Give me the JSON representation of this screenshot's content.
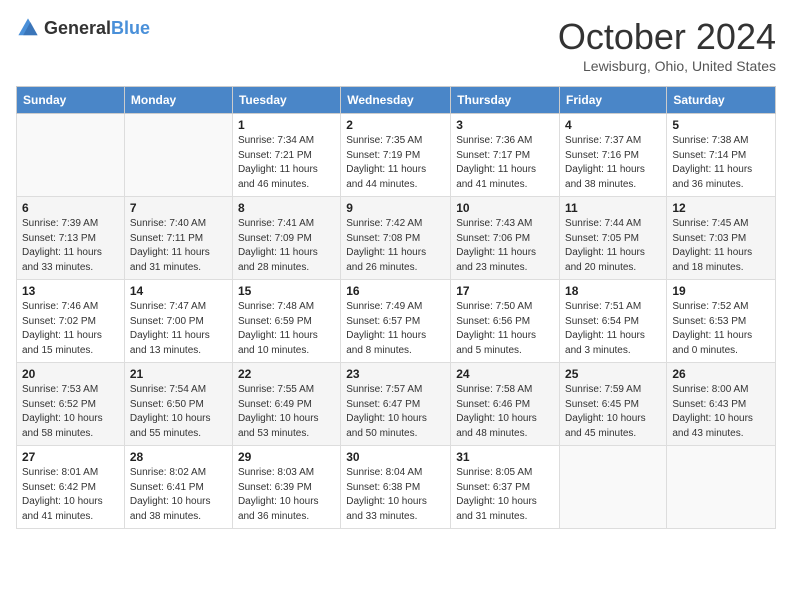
{
  "header": {
    "logo_general": "General",
    "logo_blue": "Blue",
    "month_title": "October 2024",
    "location": "Lewisburg, Ohio, United States"
  },
  "days_of_week": [
    "Sunday",
    "Monday",
    "Tuesday",
    "Wednesday",
    "Thursday",
    "Friday",
    "Saturday"
  ],
  "weeks": [
    [
      {
        "day": "",
        "info": ""
      },
      {
        "day": "",
        "info": ""
      },
      {
        "day": "1",
        "sunrise": "Sunrise: 7:34 AM",
        "sunset": "Sunset: 7:21 PM",
        "daylight": "Daylight: 11 hours and 46 minutes."
      },
      {
        "day": "2",
        "sunrise": "Sunrise: 7:35 AM",
        "sunset": "Sunset: 7:19 PM",
        "daylight": "Daylight: 11 hours and 44 minutes."
      },
      {
        "day": "3",
        "sunrise": "Sunrise: 7:36 AM",
        "sunset": "Sunset: 7:17 PM",
        "daylight": "Daylight: 11 hours and 41 minutes."
      },
      {
        "day": "4",
        "sunrise": "Sunrise: 7:37 AM",
        "sunset": "Sunset: 7:16 PM",
        "daylight": "Daylight: 11 hours and 38 minutes."
      },
      {
        "day": "5",
        "sunrise": "Sunrise: 7:38 AM",
        "sunset": "Sunset: 7:14 PM",
        "daylight": "Daylight: 11 hours and 36 minutes."
      }
    ],
    [
      {
        "day": "6",
        "sunrise": "Sunrise: 7:39 AM",
        "sunset": "Sunset: 7:13 PM",
        "daylight": "Daylight: 11 hours and 33 minutes."
      },
      {
        "day": "7",
        "sunrise": "Sunrise: 7:40 AM",
        "sunset": "Sunset: 7:11 PM",
        "daylight": "Daylight: 11 hours and 31 minutes."
      },
      {
        "day": "8",
        "sunrise": "Sunrise: 7:41 AM",
        "sunset": "Sunset: 7:09 PM",
        "daylight": "Daylight: 11 hours and 28 minutes."
      },
      {
        "day": "9",
        "sunrise": "Sunrise: 7:42 AM",
        "sunset": "Sunset: 7:08 PM",
        "daylight": "Daylight: 11 hours and 26 minutes."
      },
      {
        "day": "10",
        "sunrise": "Sunrise: 7:43 AM",
        "sunset": "Sunset: 7:06 PM",
        "daylight": "Daylight: 11 hours and 23 minutes."
      },
      {
        "day": "11",
        "sunrise": "Sunrise: 7:44 AM",
        "sunset": "Sunset: 7:05 PM",
        "daylight": "Daylight: 11 hours and 20 minutes."
      },
      {
        "day": "12",
        "sunrise": "Sunrise: 7:45 AM",
        "sunset": "Sunset: 7:03 PM",
        "daylight": "Daylight: 11 hours and 18 minutes."
      }
    ],
    [
      {
        "day": "13",
        "sunrise": "Sunrise: 7:46 AM",
        "sunset": "Sunset: 7:02 PM",
        "daylight": "Daylight: 11 hours and 15 minutes."
      },
      {
        "day": "14",
        "sunrise": "Sunrise: 7:47 AM",
        "sunset": "Sunset: 7:00 PM",
        "daylight": "Daylight: 11 hours and 13 minutes."
      },
      {
        "day": "15",
        "sunrise": "Sunrise: 7:48 AM",
        "sunset": "Sunset: 6:59 PM",
        "daylight": "Daylight: 11 hours and 10 minutes."
      },
      {
        "day": "16",
        "sunrise": "Sunrise: 7:49 AM",
        "sunset": "Sunset: 6:57 PM",
        "daylight": "Daylight: 11 hours and 8 minutes."
      },
      {
        "day": "17",
        "sunrise": "Sunrise: 7:50 AM",
        "sunset": "Sunset: 6:56 PM",
        "daylight": "Daylight: 11 hours and 5 minutes."
      },
      {
        "day": "18",
        "sunrise": "Sunrise: 7:51 AM",
        "sunset": "Sunset: 6:54 PM",
        "daylight": "Daylight: 11 hours and 3 minutes."
      },
      {
        "day": "19",
        "sunrise": "Sunrise: 7:52 AM",
        "sunset": "Sunset: 6:53 PM",
        "daylight": "Daylight: 11 hours and 0 minutes."
      }
    ],
    [
      {
        "day": "20",
        "sunrise": "Sunrise: 7:53 AM",
        "sunset": "Sunset: 6:52 PM",
        "daylight": "Daylight: 10 hours and 58 minutes."
      },
      {
        "day": "21",
        "sunrise": "Sunrise: 7:54 AM",
        "sunset": "Sunset: 6:50 PM",
        "daylight": "Daylight: 10 hours and 55 minutes."
      },
      {
        "day": "22",
        "sunrise": "Sunrise: 7:55 AM",
        "sunset": "Sunset: 6:49 PM",
        "daylight": "Daylight: 10 hours and 53 minutes."
      },
      {
        "day": "23",
        "sunrise": "Sunrise: 7:57 AM",
        "sunset": "Sunset: 6:47 PM",
        "daylight": "Daylight: 10 hours and 50 minutes."
      },
      {
        "day": "24",
        "sunrise": "Sunrise: 7:58 AM",
        "sunset": "Sunset: 6:46 PM",
        "daylight": "Daylight: 10 hours and 48 minutes."
      },
      {
        "day": "25",
        "sunrise": "Sunrise: 7:59 AM",
        "sunset": "Sunset: 6:45 PM",
        "daylight": "Daylight: 10 hours and 45 minutes."
      },
      {
        "day": "26",
        "sunrise": "Sunrise: 8:00 AM",
        "sunset": "Sunset: 6:43 PM",
        "daylight": "Daylight: 10 hours and 43 minutes."
      }
    ],
    [
      {
        "day": "27",
        "sunrise": "Sunrise: 8:01 AM",
        "sunset": "Sunset: 6:42 PM",
        "daylight": "Daylight: 10 hours and 41 minutes."
      },
      {
        "day": "28",
        "sunrise": "Sunrise: 8:02 AM",
        "sunset": "Sunset: 6:41 PM",
        "daylight": "Daylight: 10 hours and 38 minutes."
      },
      {
        "day": "29",
        "sunrise": "Sunrise: 8:03 AM",
        "sunset": "Sunset: 6:39 PM",
        "daylight": "Daylight: 10 hours and 36 minutes."
      },
      {
        "day": "30",
        "sunrise": "Sunrise: 8:04 AM",
        "sunset": "Sunset: 6:38 PM",
        "daylight": "Daylight: 10 hours and 33 minutes."
      },
      {
        "day": "31",
        "sunrise": "Sunrise: 8:05 AM",
        "sunset": "Sunset: 6:37 PM",
        "daylight": "Daylight: 10 hours and 31 minutes."
      },
      {
        "day": "",
        "info": ""
      },
      {
        "day": "",
        "info": ""
      }
    ]
  ]
}
